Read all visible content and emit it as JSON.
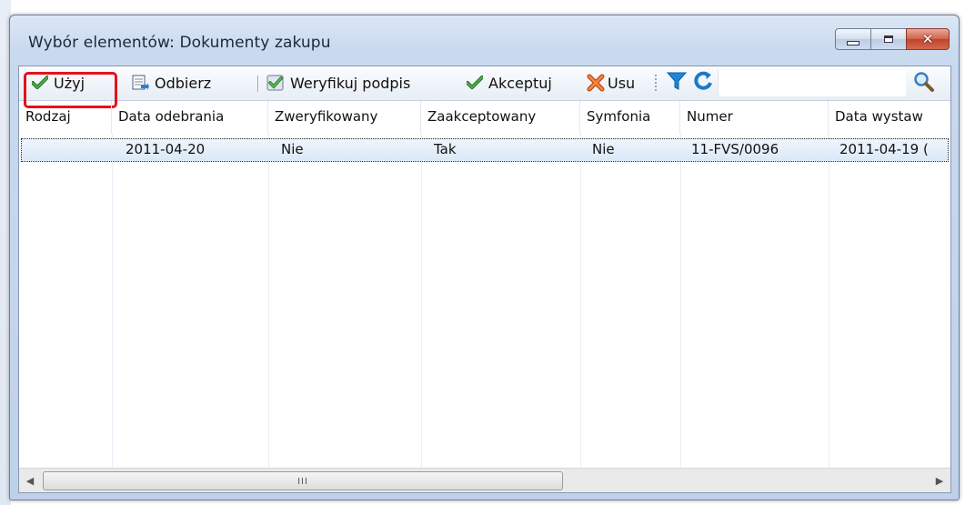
{
  "window": {
    "title": "Wybór elementów: Dokumenty zakupu",
    "min_icon": "minimize-icon",
    "max_icon": "maximize-icon",
    "close_icon": "close-icon"
  },
  "toolbar": {
    "uzyj": "Użyj",
    "odbierz": "Odbierz",
    "weryfikuj": "Weryfikuj podpis",
    "akceptuj": "Akceptuj",
    "usun": "Usu",
    "search_value": "",
    "accent": "#e2131a"
  },
  "grid": {
    "columns": [
      "Rodzaj",
      "Data odebrania",
      "Zweryfikowany",
      "Zaakceptowany",
      "Symfonia",
      "Numer",
      "Data wystaw"
    ],
    "rows": [
      [
        "",
        "2011-04-20",
        "Nie",
        "Tak",
        "Nie",
        "11-FVS/0096",
        "2011-04-19 ("
      ]
    ]
  },
  "scrollbar": {
    "grip": "III"
  }
}
